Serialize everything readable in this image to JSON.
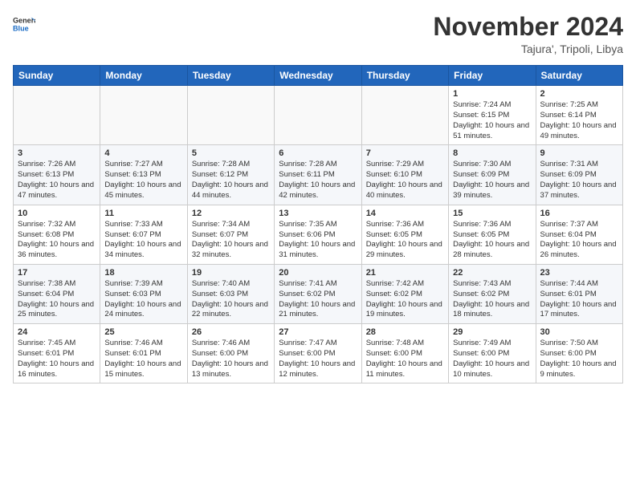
{
  "logo": {
    "general": "General",
    "blue": "Blue"
  },
  "header": {
    "month": "November 2024",
    "location": "Tajura', Tripoli, Libya"
  },
  "weekdays": [
    "Sunday",
    "Monday",
    "Tuesday",
    "Wednesday",
    "Thursday",
    "Friday",
    "Saturday"
  ],
  "weeks": [
    [
      {
        "day": "",
        "info": ""
      },
      {
        "day": "",
        "info": ""
      },
      {
        "day": "",
        "info": ""
      },
      {
        "day": "",
        "info": ""
      },
      {
        "day": "",
        "info": ""
      },
      {
        "day": "1",
        "info": "Sunrise: 7:24 AM\nSunset: 6:15 PM\nDaylight: 10 hours and 51 minutes."
      },
      {
        "day": "2",
        "info": "Sunrise: 7:25 AM\nSunset: 6:14 PM\nDaylight: 10 hours and 49 minutes."
      }
    ],
    [
      {
        "day": "3",
        "info": "Sunrise: 7:26 AM\nSunset: 6:13 PM\nDaylight: 10 hours and 47 minutes."
      },
      {
        "day": "4",
        "info": "Sunrise: 7:27 AM\nSunset: 6:13 PM\nDaylight: 10 hours and 45 minutes."
      },
      {
        "day": "5",
        "info": "Sunrise: 7:28 AM\nSunset: 6:12 PM\nDaylight: 10 hours and 44 minutes."
      },
      {
        "day": "6",
        "info": "Sunrise: 7:28 AM\nSunset: 6:11 PM\nDaylight: 10 hours and 42 minutes."
      },
      {
        "day": "7",
        "info": "Sunrise: 7:29 AM\nSunset: 6:10 PM\nDaylight: 10 hours and 40 minutes."
      },
      {
        "day": "8",
        "info": "Sunrise: 7:30 AM\nSunset: 6:09 PM\nDaylight: 10 hours and 39 minutes."
      },
      {
        "day": "9",
        "info": "Sunrise: 7:31 AM\nSunset: 6:09 PM\nDaylight: 10 hours and 37 minutes."
      }
    ],
    [
      {
        "day": "10",
        "info": "Sunrise: 7:32 AM\nSunset: 6:08 PM\nDaylight: 10 hours and 36 minutes."
      },
      {
        "day": "11",
        "info": "Sunrise: 7:33 AM\nSunset: 6:07 PM\nDaylight: 10 hours and 34 minutes."
      },
      {
        "day": "12",
        "info": "Sunrise: 7:34 AM\nSunset: 6:07 PM\nDaylight: 10 hours and 32 minutes."
      },
      {
        "day": "13",
        "info": "Sunrise: 7:35 AM\nSunset: 6:06 PM\nDaylight: 10 hours and 31 minutes."
      },
      {
        "day": "14",
        "info": "Sunrise: 7:36 AM\nSunset: 6:05 PM\nDaylight: 10 hours and 29 minutes."
      },
      {
        "day": "15",
        "info": "Sunrise: 7:36 AM\nSunset: 6:05 PM\nDaylight: 10 hours and 28 minutes."
      },
      {
        "day": "16",
        "info": "Sunrise: 7:37 AM\nSunset: 6:04 PM\nDaylight: 10 hours and 26 minutes."
      }
    ],
    [
      {
        "day": "17",
        "info": "Sunrise: 7:38 AM\nSunset: 6:04 PM\nDaylight: 10 hours and 25 minutes."
      },
      {
        "day": "18",
        "info": "Sunrise: 7:39 AM\nSunset: 6:03 PM\nDaylight: 10 hours and 24 minutes."
      },
      {
        "day": "19",
        "info": "Sunrise: 7:40 AM\nSunset: 6:03 PM\nDaylight: 10 hours and 22 minutes."
      },
      {
        "day": "20",
        "info": "Sunrise: 7:41 AM\nSunset: 6:02 PM\nDaylight: 10 hours and 21 minutes."
      },
      {
        "day": "21",
        "info": "Sunrise: 7:42 AM\nSunset: 6:02 PM\nDaylight: 10 hours and 19 minutes."
      },
      {
        "day": "22",
        "info": "Sunrise: 7:43 AM\nSunset: 6:02 PM\nDaylight: 10 hours and 18 minutes."
      },
      {
        "day": "23",
        "info": "Sunrise: 7:44 AM\nSunset: 6:01 PM\nDaylight: 10 hours and 17 minutes."
      }
    ],
    [
      {
        "day": "24",
        "info": "Sunrise: 7:45 AM\nSunset: 6:01 PM\nDaylight: 10 hours and 16 minutes."
      },
      {
        "day": "25",
        "info": "Sunrise: 7:46 AM\nSunset: 6:01 PM\nDaylight: 10 hours and 15 minutes."
      },
      {
        "day": "26",
        "info": "Sunrise: 7:46 AM\nSunset: 6:00 PM\nDaylight: 10 hours and 13 minutes."
      },
      {
        "day": "27",
        "info": "Sunrise: 7:47 AM\nSunset: 6:00 PM\nDaylight: 10 hours and 12 minutes."
      },
      {
        "day": "28",
        "info": "Sunrise: 7:48 AM\nSunset: 6:00 PM\nDaylight: 10 hours and 11 minutes."
      },
      {
        "day": "29",
        "info": "Sunrise: 7:49 AM\nSunset: 6:00 PM\nDaylight: 10 hours and 10 minutes."
      },
      {
        "day": "30",
        "info": "Sunrise: 7:50 AM\nSunset: 6:00 PM\nDaylight: 10 hours and 9 minutes."
      }
    ]
  ]
}
